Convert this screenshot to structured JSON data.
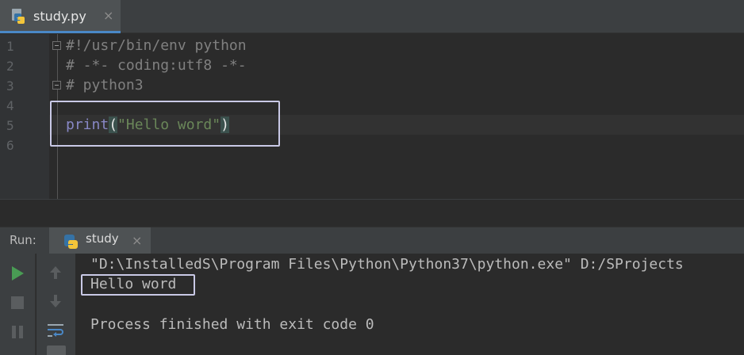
{
  "editor_tab": {
    "title": "study.py",
    "close": "×",
    "icon": "python-file-icon"
  },
  "editor": {
    "line_numbers": [
      "1",
      "2",
      "3",
      "4",
      "5",
      "6"
    ],
    "lines": {
      "l1": "#!/usr/bin/env python",
      "l2": "# -*- coding:utf8 -*-",
      "l3": "# python3",
      "l5_func": "print",
      "l5_open": "(",
      "l5_str": "\"Hello word\"",
      "l5_close": ")"
    }
  },
  "run_panel": {
    "label": "Run:",
    "tab_title": "study",
    "tab_close": "×",
    "console": {
      "command": "\"D:\\InstalledS\\Program Files\\Python\\Python37\\python.exe\" D:/SProjects",
      "output": "Hello word",
      "exit": "Process finished with exit code 0"
    }
  },
  "colors": {
    "keyword": "#8888c6",
    "string": "#6a8759",
    "comment": "#808080",
    "run_green": "#499c54",
    "highlight_box": "#c9c9e6"
  }
}
